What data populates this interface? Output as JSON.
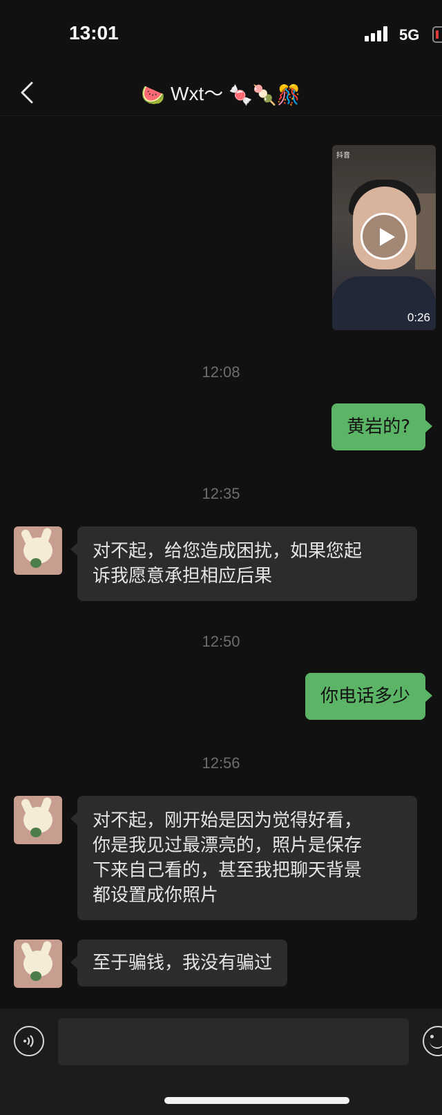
{
  "status_bar": {
    "time": "13:01",
    "network": "5G",
    "battery_color": "#e03a3a"
  },
  "nav": {
    "back_icon": "chevron-left-icon",
    "title_prefix_emoji": "🍉",
    "title_text": "Wxt～",
    "title_suffix_emoji": "🍬🍡🎊"
  },
  "messages": [
    {
      "type": "video",
      "direction": "out",
      "duration": "0:26",
      "source_label": "抖音"
    },
    {
      "type": "timestamp",
      "text": "12:08"
    },
    {
      "type": "text",
      "direction": "out",
      "text": "黄岩的?"
    },
    {
      "type": "timestamp",
      "text": "12:35"
    },
    {
      "type": "text",
      "direction": "in",
      "lines": [
        "对不起，给您造成困扰，如果您起",
        "诉我愿意承担相应后果"
      ]
    },
    {
      "type": "timestamp",
      "text": "12:50"
    },
    {
      "type": "text",
      "direction": "out",
      "text": "你电话多少"
    },
    {
      "type": "timestamp",
      "text": "12:56"
    },
    {
      "type": "text",
      "direction": "in",
      "lines": [
        "对不起，刚开始是因为觉得好看，",
        "你是我见过最漂亮的，照片是保存",
        "下来自己看的，甚至我把聊天背景",
        "都设置成你照片"
      ]
    },
    {
      "type": "text",
      "direction": "in",
      "text": "至于骗钱，我没有骗过"
    }
  ],
  "input_bar": {
    "voice_icon": "voice-icon",
    "emoji_icon": "emoji-icon",
    "input_value": ""
  },
  "colors": {
    "background": "#111111",
    "incoming_bubble": "#2c2c2c",
    "outgoing_bubble": "#5cb567",
    "timestamp": "#6d6d6d"
  }
}
